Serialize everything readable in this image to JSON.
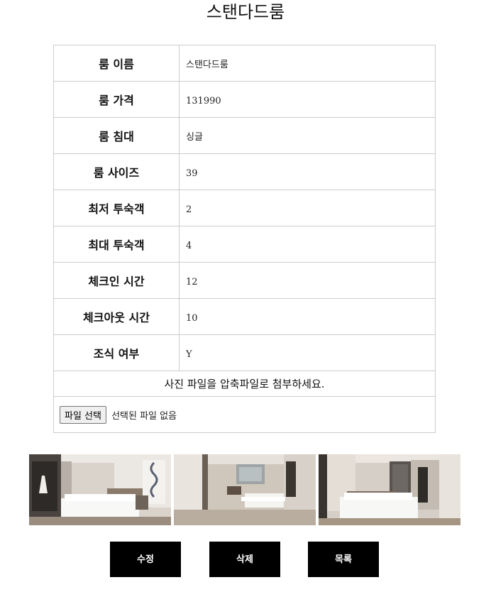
{
  "page": {
    "title": "스탠다드룸"
  },
  "form": {
    "rows": [
      {
        "label": "룸 이름",
        "value": "스탠다드룸"
      },
      {
        "label": "룸 가격",
        "value": "131990"
      },
      {
        "label": "룸 침대",
        "value": "싱글"
      },
      {
        "label": "룸 사이즈",
        "value": "39"
      },
      {
        "label": "최저 투숙객",
        "value": "2"
      },
      {
        "label": "최대 투숙객",
        "value": "4"
      },
      {
        "label": "체크인 시간",
        "value": "12"
      },
      {
        "label": "체크아웃 시간",
        "value": "10"
      },
      {
        "label": "조식 여부",
        "value": "Y"
      }
    ],
    "notice": "사진 파일을 압축파일로 첨부하세요.",
    "file_button": "파일 선택",
    "file_status": "선택된 파일 없음"
  },
  "buttons": {
    "edit": "수정",
    "delete": "삭제",
    "list": "목록"
  },
  "colors": {
    "button_bg": "#000000",
    "button_text": "#ffffff",
    "border": "#cccccc"
  }
}
